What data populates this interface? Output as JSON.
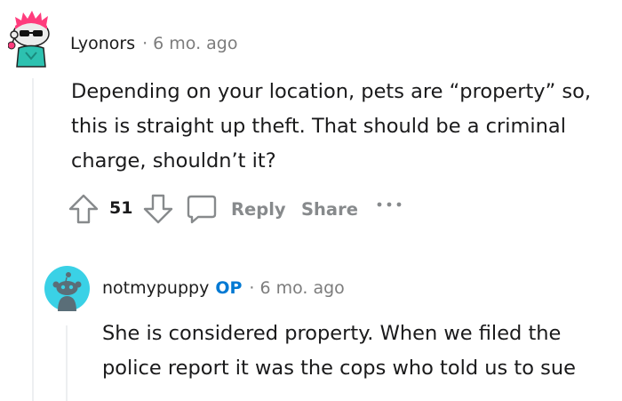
{
  "comment": {
    "username": "Lyonors",
    "age": "6 mo. ago",
    "separator": "·",
    "body": "Depending on your location, pets are “property” so, this is straight up theft. That should be a criminal charge, shouldn’t it?",
    "votes": "51",
    "actions": {
      "reply_label": "Reply",
      "share_label": "Share",
      "more_label": "···"
    }
  },
  "reply": {
    "username": "notmypuppy",
    "op_badge": "OP",
    "age": "6 mo. ago",
    "separator": "·",
    "body": "She is considered property. When we filed the police report it was the cops who told us to sue"
  },
  "colors": {
    "op_blue": "#0079d3",
    "meta_gray": "#7c7c7c",
    "action_gray": "#878a8c",
    "reply_avatar_bg": "#3ad1e6"
  },
  "icons": [
    "snoo-avatar-icon",
    "upvote-arrow-icon",
    "downvote-arrow-icon",
    "comment-bubble-icon",
    "more-dots-icon",
    "default-snoo-avatar-icon"
  ]
}
